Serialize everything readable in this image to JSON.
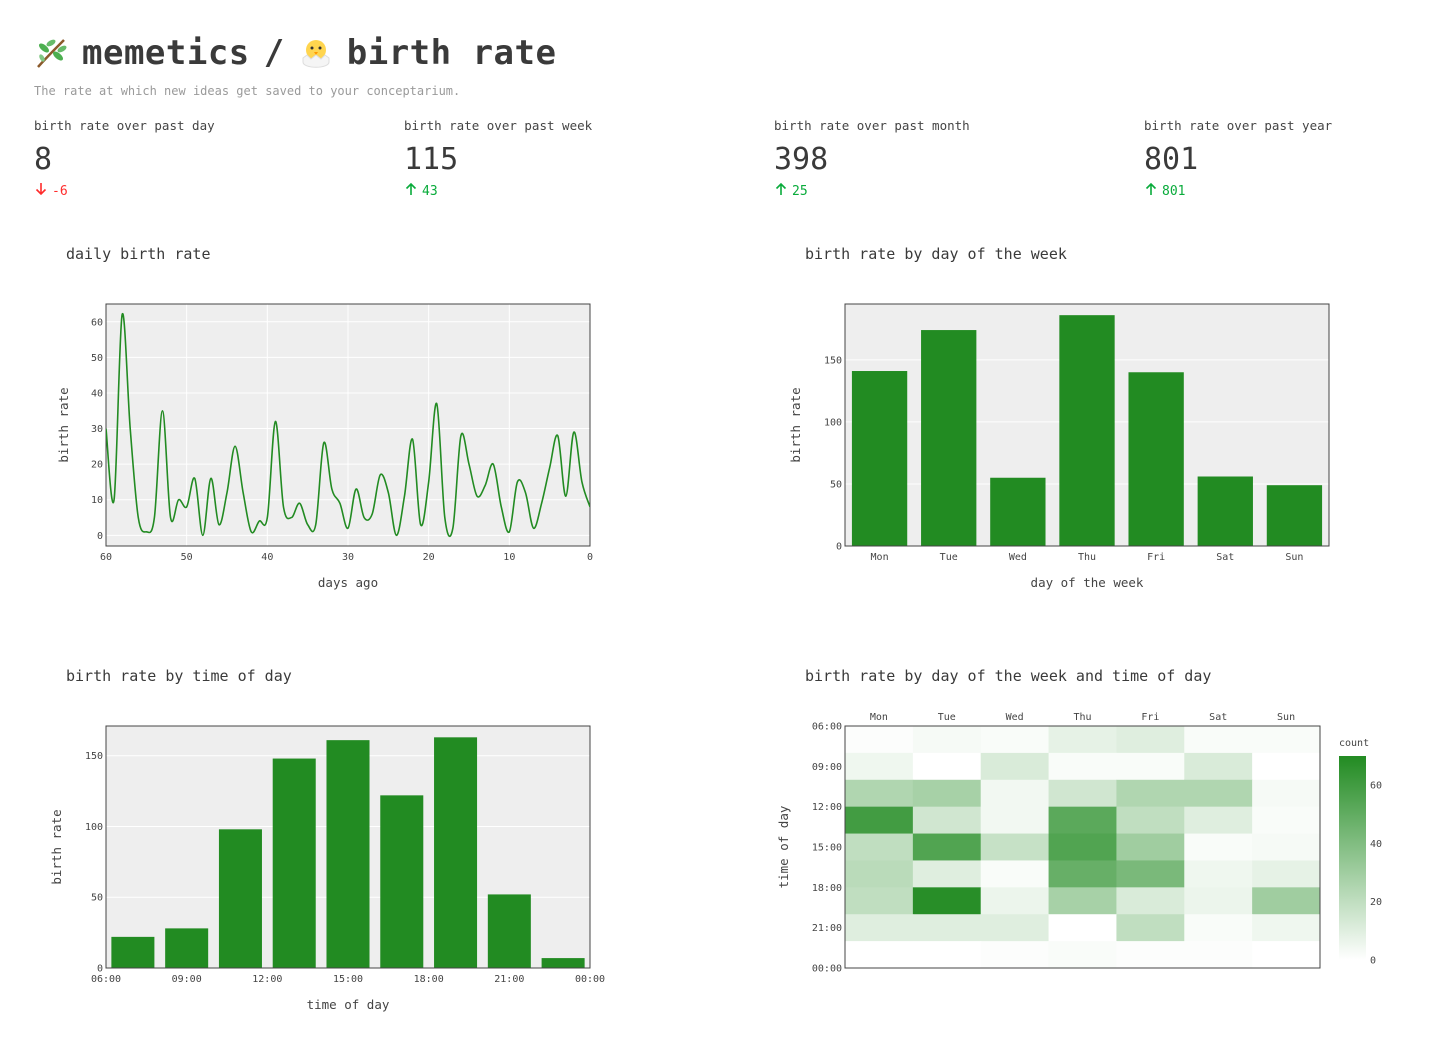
{
  "header": {
    "app_name": "memetics",
    "separator": "/",
    "page_name": "birth rate",
    "subtitle": "The rate at which new ideas get saved to your conceptarium.",
    "app_icon": "sprout-branch-icon",
    "page_icon": "hatching-chick-icon"
  },
  "metrics": [
    {
      "label": "birth rate over past day",
      "value": "8",
      "delta": "-6",
      "direction": "down"
    },
    {
      "label": "birth rate over past week",
      "value": "115",
      "delta": "43",
      "direction": "up"
    },
    {
      "label": "birth rate over past month",
      "value": "398",
      "delta": "25",
      "direction": "up"
    },
    {
      "label": "birth rate over past year",
      "value": "801",
      "delta": "801",
      "direction": "up"
    }
  ],
  "colors": {
    "accent": "#228b22",
    "plot_bg": "#eeeeee",
    "delta_up": "#09ab3b",
    "delta_down": "#ff2b2b"
  },
  "chart_data": [
    {
      "id": "daily",
      "type": "line",
      "title": "daily birth rate",
      "xlabel": "days ago",
      "ylabel": "birth rate",
      "xlim": [
        60,
        0
      ],
      "ylim": [
        -3,
        65
      ],
      "xticks": [
        60,
        50,
        40,
        30,
        20,
        10,
        0
      ],
      "yticks": [
        0,
        10,
        20,
        30,
        40,
        50,
        60
      ],
      "grid": true,
      "x": [
        60,
        59,
        58,
        57,
        56,
        55,
        54,
        53,
        52,
        51,
        50,
        49,
        48,
        47,
        46,
        45,
        44,
        43,
        42,
        41,
        40,
        39,
        38,
        37,
        36,
        35,
        34,
        33,
        32,
        31,
        30,
        29,
        28,
        27,
        26,
        25,
        24,
        23,
        22,
        21,
        20,
        19,
        18,
        17,
        16,
        15,
        14,
        13,
        12,
        11,
        10,
        9,
        8,
        7,
        6,
        5,
        4,
        3,
        2,
        1,
        0
      ],
      "y": [
        30,
        10,
        62,
        30,
        5,
        1,
        5,
        35,
        5,
        10,
        8,
        16,
        0,
        16,
        3,
        12,
        25,
        12,
        1,
        4,
        5,
        32,
        8,
        5,
        9,
        3,
        3,
        26,
        13,
        9,
        2,
        13,
        5,
        6,
        17,
        12,
        0,
        11,
        27,
        3,
        15,
        37,
        5,
        2,
        28,
        20,
        11,
        14,
        20,
        8,
        1,
        15,
        12,
        2,
        9,
        19,
        28,
        11,
        29,
        15,
        8
      ]
    },
    {
      "id": "weekday",
      "type": "bar",
      "title": "birth rate by day of the week",
      "xlabel": "day of the week",
      "ylabel": "birth rate",
      "ylim": [
        0,
        195
      ],
      "yticks": [
        0,
        50,
        100,
        150
      ],
      "categories": [
        "Mon",
        "Tue",
        "Wed",
        "Thu",
        "Fri",
        "Sat",
        "Sun"
      ],
      "values": [
        141,
        174,
        55,
        186,
        140,
        56,
        49
      ]
    },
    {
      "id": "timeofday",
      "type": "bar",
      "title": "birth rate by time of day",
      "xlabel": "time of day",
      "ylabel": "birth rate",
      "ylim": [
        0,
        171
      ],
      "yticks": [
        0,
        50,
        100,
        150
      ],
      "xticks": [
        "06:00",
        "09:00",
        "12:00",
        "15:00",
        "18:00",
        "21:00",
        "00:00"
      ],
      "bin_hours": [
        6,
        8,
        10,
        12,
        14,
        16,
        18,
        20,
        22
      ],
      "values": [
        22,
        28,
        98,
        148,
        161,
        122,
        163,
        52,
        7
      ]
    },
    {
      "id": "heatmap",
      "type": "heatmap",
      "title": "birth rate by day of the week and time of day",
      "ylabel": "time of day",
      "columns": [
        "Mon",
        "Tue",
        "Wed",
        "Thu",
        "Fri",
        "Sat",
        "Sun"
      ],
      "yticks": [
        "06:00",
        "09:00",
        "12:00",
        "15:00",
        "18:00",
        "21:00",
        "00:00"
      ],
      "zrange": [
        0,
        70
      ],
      "colorbar_title": "count",
      "colorbar_ticks": [
        0,
        20,
        40,
        60
      ],
      "rows": [
        [
          1,
          3,
          2,
          8,
          10,
          2,
          2
        ],
        [
          5,
          0,
          12,
          2,
          2,
          12,
          0
        ],
        [
          25,
          28,
          4,
          15,
          25,
          25,
          3
        ],
        [
          60,
          15,
          4,
          52,
          20,
          10,
          2
        ],
        [
          20,
          55,
          18,
          55,
          30,
          2,
          3
        ],
        [
          22,
          10,
          2,
          48,
          42,
          5,
          8
        ],
        [
          20,
          68,
          6,
          28,
          12,
          6,
          30
        ],
        [
          10,
          10,
          10,
          0,
          20,
          2,
          5
        ],
        [
          0,
          0,
          1,
          2,
          1,
          1,
          0
        ]
      ]
    }
  ]
}
